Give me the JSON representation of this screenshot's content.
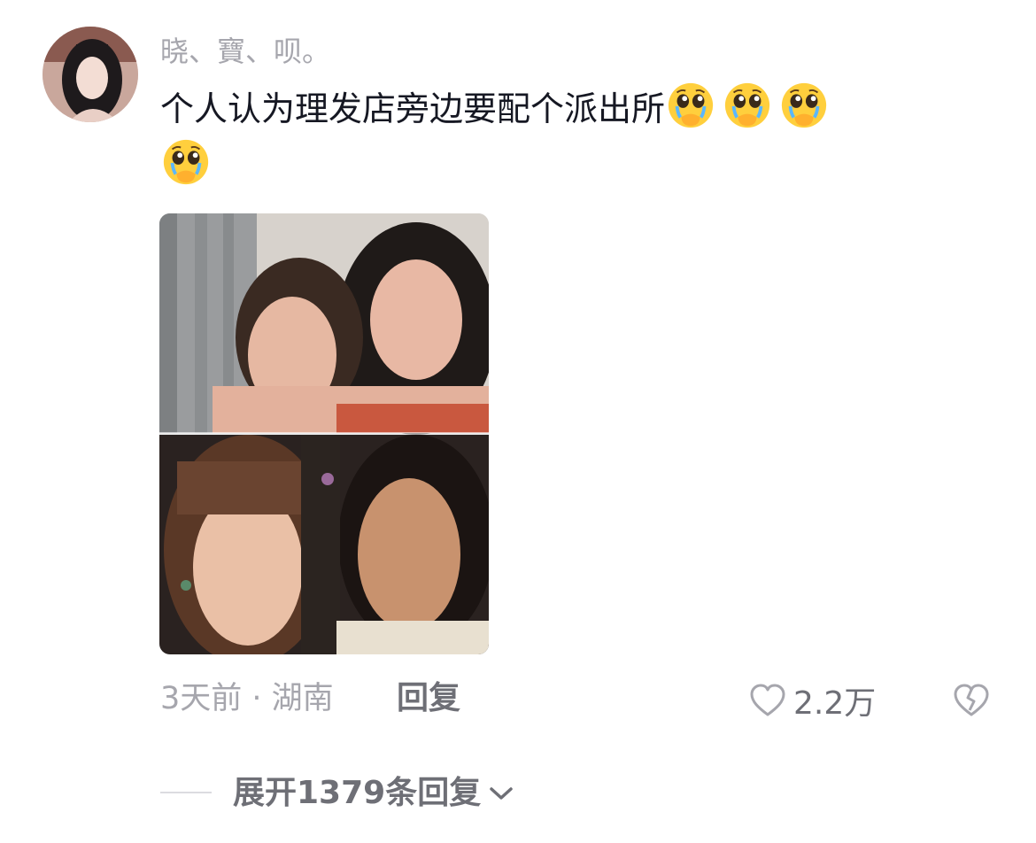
{
  "comment": {
    "username": "晓、寶、呗。",
    "text": "个人认为理发店旁边要配个派出所",
    "emojis": [
      "crying-face-emoji",
      "crying-face-emoji",
      "crying-face-emoji",
      "crying-face-emoji"
    ],
    "time_location": "3天前 · 湖南",
    "reply_label": "回复",
    "like_count": "2.2万",
    "expand_label": "展开1379条回复"
  },
  "colors": {
    "primary_text": "#161823",
    "secondary_text": "#a6a6ad",
    "action_text": "#6e6f76"
  }
}
